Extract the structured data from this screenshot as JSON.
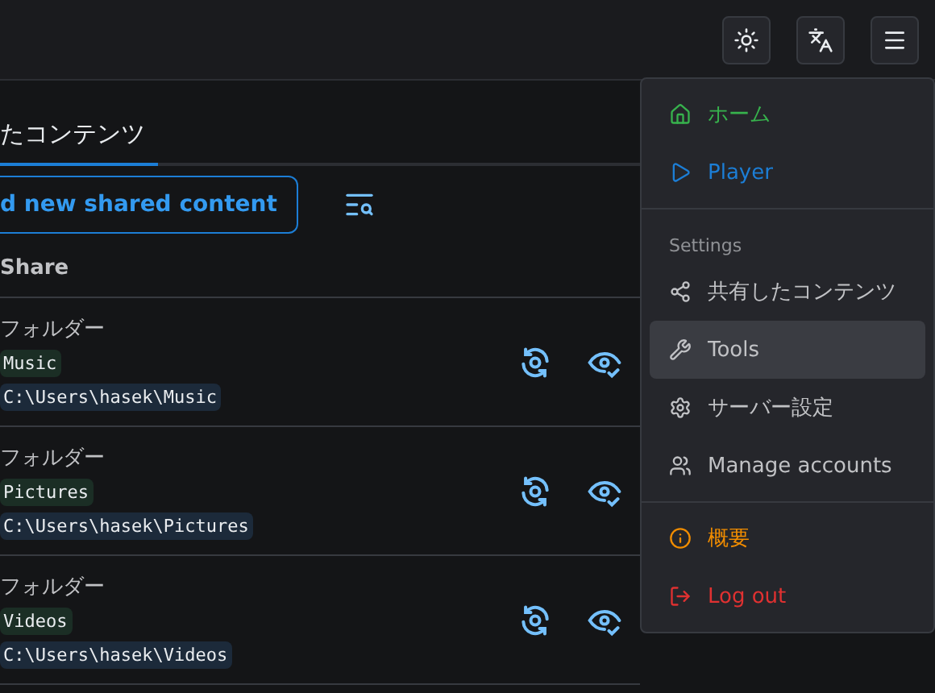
{
  "header": {
    "buttons": [
      {
        "kind": "theme"
      },
      {
        "kind": "language"
      },
      {
        "kind": "menu"
      }
    ]
  },
  "tabs": [
    {
      "label": "たコンテンツ",
      "selected": true
    }
  ],
  "toolbar": {
    "add_button": "d new shared content"
  },
  "table": {
    "columns": [
      "Share"
    ],
    "rows": [
      {
        "type": "フォルダー",
        "name": "Music",
        "path": "C:\\Users\\hasek\\Music"
      },
      {
        "type": "フォルダー",
        "name": "Pictures",
        "path": "C:\\Users\\hasek\\Pictures"
      },
      {
        "type": "フォルダー",
        "name": "Videos",
        "path": "C:\\Users\\hasek\\Videos"
      }
    ]
  },
  "menu": {
    "items": [
      {
        "kind": "link",
        "label": "ホーム",
        "color": "#37b24d",
        "selected": false
      },
      {
        "kind": "link",
        "label": "Player",
        "color": "#1c7ed6",
        "selected": false
      },
      {
        "kind": "divider"
      },
      {
        "kind": "section",
        "label": "Settings"
      },
      {
        "kind": "link",
        "label": "共有したコンテンツ",
        "color": "#c1c2c5",
        "selected": false
      },
      {
        "kind": "link",
        "label": "Tools",
        "color": "#c1c2c5",
        "selected": true
      },
      {
        "kind": "link",
        "label": "サーバー設定",
        "color": "#c1c2c5",
        "selected": false
      },
      {
        "kind": "link",
        "label": "Manage accounts",
        "color": "#c1c2c5",
        "selected": false
      },
      {
        "kind": "divider"
      },
      {
        "kind": "link",
        "label": "概要",
        "color": "#f08c00",
        "selected": false
      },
      {
        "kind": "link",
        "label": "Log out",
        "color": "#e03131",
        "selected": false
      }
    ]
  }
}
